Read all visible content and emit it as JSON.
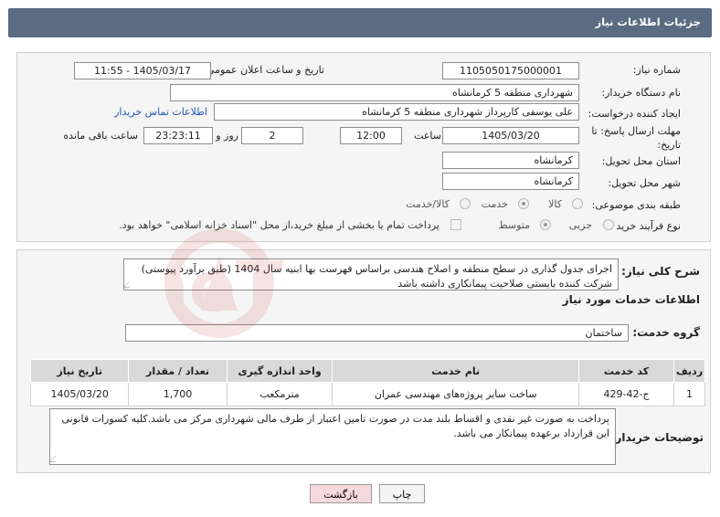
{
  "header": {
    "title": "جزئیات اطلاعات نیاز"
  },
  "form": {
    "need_number_label": "شماره نیاز:",
    "need_number": "1105050175000001",
    "announce_label": "تاریخ و ساعت اعلان عمومی:",
    "announce_value": "1405/03/17 - 11:55",
    "buyer_org_label": "نام دستگاه خریدار:",
    "buyer_org": "شهرداری منطقه 5 کرمانشاه",
    "requester_label": "ایجاد کننده درخواست:",
    "requester": "علی یوسفی کارپرداز شهرداری منطقه 5 کرمانشاه",
    "contact_link": "اطلاعات تماس خریدار",
    "deadline_label_1": "مهلت ارسال پاسخ: تا",
    "deadline_label_2": "تاریخ:",
    "deadline_date": "1405/03/20",
    "time_label": "ساعت",
    "deadline_time": "12:00",
    "days_value": "2",
    "days_label": "روز و",
    "remaining_time": "23:23:11",
    "remaining_label": "ساعت باقی مانده",
    "province_label": "استان محل تحویل:",
    "province": "کرمانشاه",
    "city_label": "شهر محل تحویل:",
    "city": "کرمانشاه",
    "category_label": "طبقه بندی موضوعی:",
    "category_options": [
      "کالا",
      "خدمت",
      "کالا/خدمت"
    ],
    "process_label": "نوع فرآیند خرید :",
    "process_options": [
      "جزیی",
      "متوسط"
    ],
    "payment_note": "پرداخت تمام یا بخشی از مبلغ خرید،از محل \"اسناد خزانه اسلامی\" خواهد بود."
  },
  "description": {
    "label": "شرح کلی نیاز:",
    "text": "اجرای جدول گذاری در سطح منطقه و اصلاح هندسی براساس فهرست بها ابنیه سال 1404 (طبق برآورد پیوستی) شرکت کننده بایستی صلاحیت پیمانکاری داشته باشد"
  },
  "services": {
    "section_title": "اطلاعات خدمات مورد نیاز",
    "group_label": "گروه خدمت:",
    "group_value": "ساختمان",
    "columns": [
      "ردیف",
      "کد خدمت",
      "نام خدمت",
      "واحد اندازه گیری",
      "تعداد / مقدار",
      "تاریخ نیاز"
    ],
    "rows": [
      [
        "1",
        "ج-42-429",
        "ساخت سایر پروژه‌های مهندسی عمران",
        "مترمکعب",
        "1,700",
        "1405/03/20"
      ]
    ]
  },
  "buyer_notes": {
    "label": "توضیحات خریدار:",
    "text": "پرداخت به صورت غیر نقدی و اقساط بلند مدت در صورت تامین اعتبار از طرف مالی شهرداری مرکز می باشد.کلیه کسورات قانونی این قرارداد برعهده پیمانکار می باشد."
  },
  "buttons": {
    "print": "چاپ",
    "back": "بازگشت"
  },
  "colors": {
    "header": "#5a6b82",
    "link": "#2255bb",
    "back_button": "#f7d9dd"
  },
  "watermark_text": "AriaTender.neT"
}
